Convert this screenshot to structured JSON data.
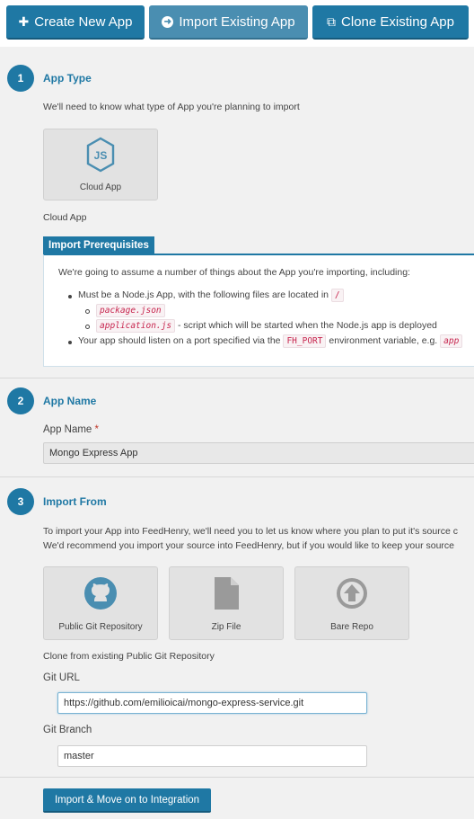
{
  "top_buttons": {
    "create": "Create New App",
    "import": "Import Existing App",
    "clone": "Clone Existing App"
  },
  "step1": {
    "number": "1",
    "title": "App Type",
    "description": "We'll need to know what type of App you're planning to import",
    "tile_label": "Cloud App",
    "selected_text": "Cloud App"
  },
  "prereq": {
    "title": "Import Prerequisites",
    "intro": "We're going to assume a number of things about the App you're importing, including:",
    "item1": "Must be a Node.js App, with the following files are located in",
    "item1_code": "/",
    "file1": "package.json",
    "file2": "application.js",
    "file2_desc": "- script which will be started when the Node.js app is deployed",
    "item2_pre": "Your app should listen on a port specified via the",
    "item2_code": "FH_PORT",
    "item2_post": "environment variable, e.g.",
    "item2_code2": "app"
  },
  "step2": {
    "number": "2",
    "title": "App Name",
    "field_label": "App Name",
    "required_mark": "*",
    "field_value": "Mongo Express App"
  },
  "step3": {
    "number": "3",
    "title": "Import From",
    "desc1": "To import your App into FeedHenry, we'll need you to let us know where you plan to put it's source c",
    "desc2": "We'd recommend you import your source into FeedHenry, but if you would like to keep your source",
    "tiles": [
      "Public Git Repository",
      "Zip File",
      "Bare Repo"
    ],
    "selected_text": "Clone from existing Public Git Repository",
    "git_url_label": "Git URL",
    "git_url_value": "https://github.com/emilioicai/mongo-express-service.git",
    "git_branch_label": "Git Branch",
    "git_branch_value": "master"
  },
  "submit_label": "Import & Move on to Integration",
  "colors": {
    "primary": "#1f78a4",
    "background": "#f1f1f1",
    "code": "#c7254e"
  }
}
